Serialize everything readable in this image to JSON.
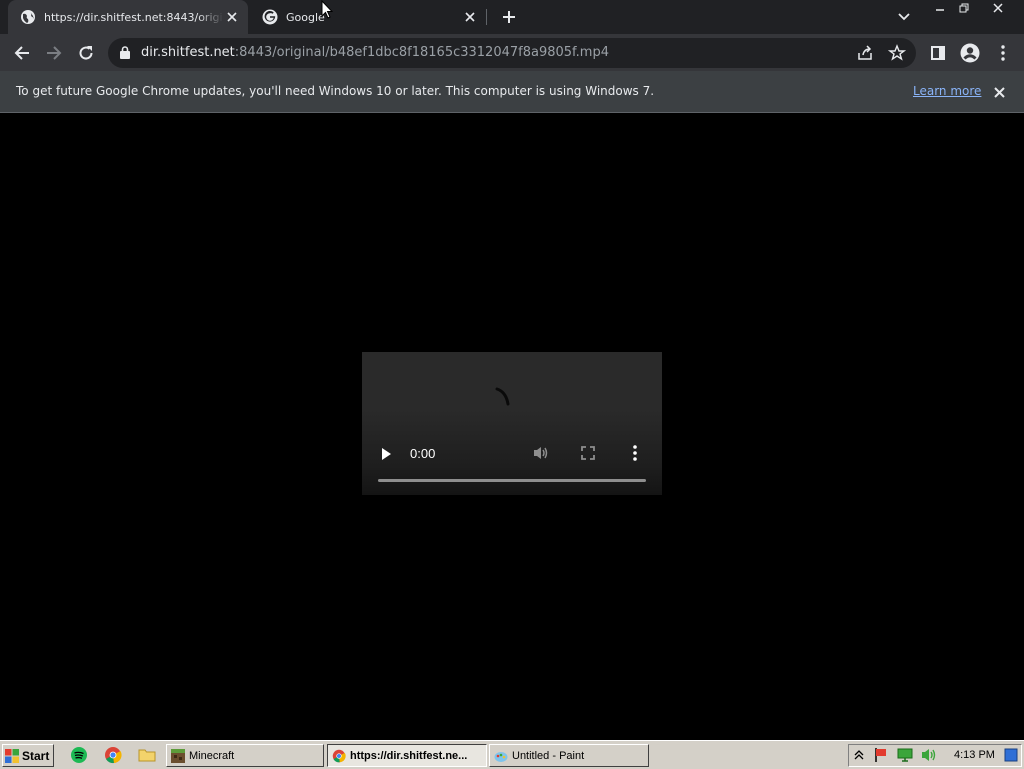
{
  "tabs": [
    {
      "title": "https://dir.shitfest.net:8443/original/b48ef1dbc8f18165c3312047f8a9805f.mp4",
      "active": true,
      "favicon": "globe-icon"
    },
    {
      "title": "Google",
      "active": false,
      "favicon": "google-icon"
    }
  ],
  "toolbar": {
    "url_host": "dir.shitfest.net",
    "url_rest": ":8443/original/b48ef1dbc8f18165c3312047f8a9805f.mp4"
  },
  "infobar": {
    "message": "To get future Google Chrome updates, you'll need Windows 10 or later. This computer is using Windows 7.",
    "link": "Learn more"
  },
  "video": {
    "time": "0:00",
    "progress": 0
  },
  "taskbar": {
    "start_label": "Start",
    "items": [
      {
        "label": "Minecraft",
        "pressed": false
      },
      {
        "label": "https://dir.shitfest.ne...",
        "pressed": true
      },
      {
        "label": "Untitled - Paint",
        "pressed": false
      }
    ],
    "clock": "4:13 PM"
  },
  "colors": {
    "tab_strip": "#202124",
    "toolbar": "#35363a",
    "infobar": "#3c4043",
    "link": "#8ab4f8",
    "taskbar": "#d4d0c8"
  }
}
